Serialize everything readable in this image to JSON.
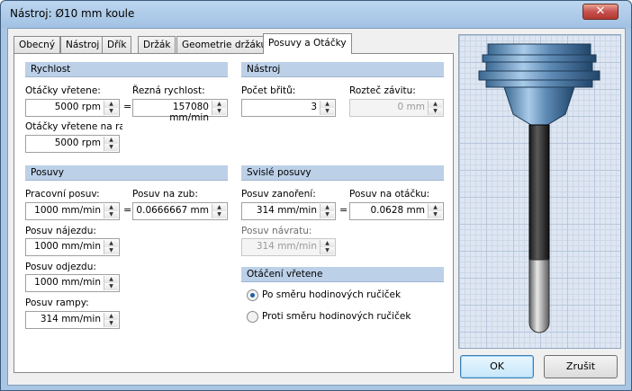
{
  "window": {
    "title": "Nástroj: Ø10 mm koule",
    "close_glyph": "✕"
  },
  "tabs": [
    {
      "label": "Obecný"
    },
    {
      "label": "Nástroj"
    },
    {
      "label": "Dřík"
    },
    {
      "label": "Držák"
    },
    {
      "label": "Geometrie držáku"
    },
    {
      "label": "Posuvy a Otáčky",
      "active": true
    }
  ],
  "rychlost": {
    "header": "Rychlost",
    "spindle_speed_label": "Otáčky vřetene:",
    "spindle_speed_value": "5000 rpm",
    "cutting_speed_label": "Řezná rychlost:",
    "cutting_speed_value": "157080 mm/min",
    "ramp_speed_label": "Otáčky vřetene na rar",
    "ramp_speed_value": "5000 rpm",
    "equals": "="
  },
  "nastroj": {
    "header": "Nástroj",
    "teeth_label": "Počet břitů:",
    "teeth_value": "3",
    "pitch_label": "Rozteč závitu:",
    "pitch_value": "0 mm"
  },
  "posuvy": {
    "header": "Posuvy",
    "work_feed_label": "Pracovní posuv:",
    "work_feed_value": "1000 mm/min",
    "per_tooth_label": "Posuv na zub:",
    "per_tooth_value": "0.0666667 mm",
    "approach_label": "Posuv nájezdu:",
    "approach_value": "1000 mm/min",
    "retract_label": "Posuv odjezdu:",
    "retract_value": "1000 mm/min",
    "ramp_label": "Posuv rampy:",
    "ramp_value": "314 mm/min",
    "equals": "="
  },
  "svisle": {
    "header": "Svislé posuvy",
    "plunge_label": "Posuv zanoření:",
    "plunge_value": "314 mm/min",
    "per_rev_label": "Posuv na otáčku:",
    "per_rev_value": "0.0628 mm",
    "return_label": "Posuv návratu:",
    "return_value": "314 mm/min",
    "equals": "="
  },
  "otaceni": {
    "header": "Otáčení vřetene",
    "cw_label": "Po směru hodinových ručiček",
    "ccw_label": "Proti směru hodinových ručiček",
    "selected": "cw"
  },
  "spin_up": "▲",
  "spin_down": "▼",
  "buttons": {
    "ok": "OK",
    "cancel": "Zrušit"
  }
}
